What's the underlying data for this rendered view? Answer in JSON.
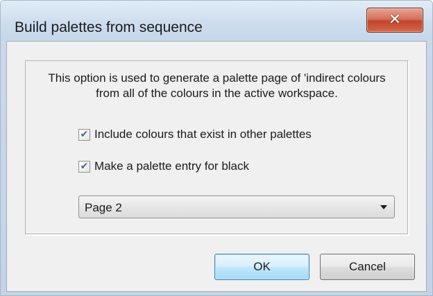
{
  "window": {
    "title": "Build palettes from sequence",
    "close_icon": "close-icon"
  },
  "dialog": {
    "description": "This option is used to generate a palette page of 'indirect colours from all of the colours in the active workspace.",
    "options": [
      {
        "label": "Include colours that exist in other palettes",
        "checked": true
      },
      {
        "label": "Make a palette entry for black",
        "checked": true
      }
    ],
    "page_select": {
      "selected": "Page 2"
    }
  },
  "buttons": {
    "ok_label": "OK",
    "cancel_label": "Cancel"
  },
  "colors": {
    "close_button": "#c2432a",
    "checkmark": "#4a5f97",
    "default_button_border": "#3c7fb1"
  }
}
